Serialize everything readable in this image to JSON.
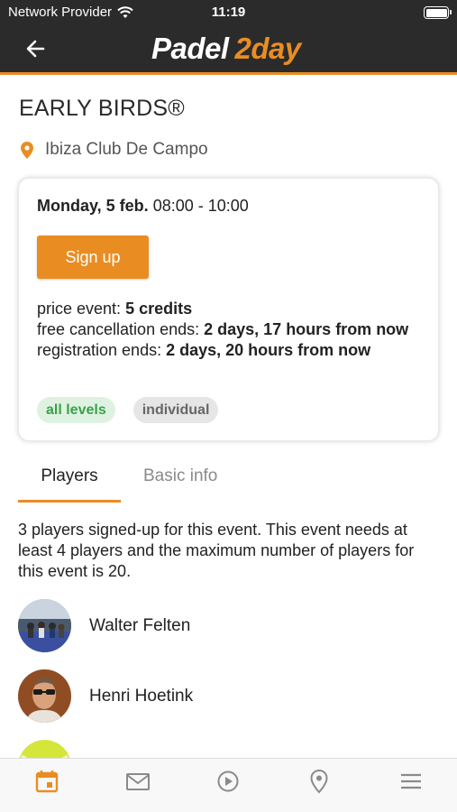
{
  "status_bar": {
    "carrier": "Network Provider",
    "time": "11:19"
  },
  "header": {
    "logo_part1": "Padel",
    "logo_part2": "2day"
  },
  "event": {
    "title": "EARLY BIRDS®",
    "location": "Ibiza Club De Campo",
    "date_bold": "Monday, 5 feb.",
    "time_range": "08:00 - 10:00",
    "signup_label": "Sign up",
    "price_label": "price event: ",
    "price_value": "5 credits",
    "cancel_label": "free cancellation ends: ",
    "cancel_value": "2 days, 17 hours from now",
    "registration_label": "registration ends: ",
    "registration_value": "2 days, 20 hours from now",
    "tags": [
      "all levels",
      "individual"
    ]
  },
  "tabs": {
    "players": "Players",
    "basic_info": "Basic info"
  },
  "players_description": "3 players signed-up for this event. This event needs at least 4 players and the maximum number of players for this event is 20.",
  "players": [
    {
      "name": "Walter Felten"
    },
    {
      "name": "Henri Hoetink"
    },
    {
      "name": ""
    }
  ],
  "bottom_nav": {
    "items": [
      "calendar-icon",
      "mail-icon",
      "play-icon",
      "location-icon",
      "menu-icon"
    ],
    "active_color": "#e98d23",
    "inactive_color": "#8a8a8a"
  },
  "colors": {
    "accent": "#e98d23",
    "header_bg": "#2b2b2b",
    "tag_green": "#3aa14a"
  }
}
